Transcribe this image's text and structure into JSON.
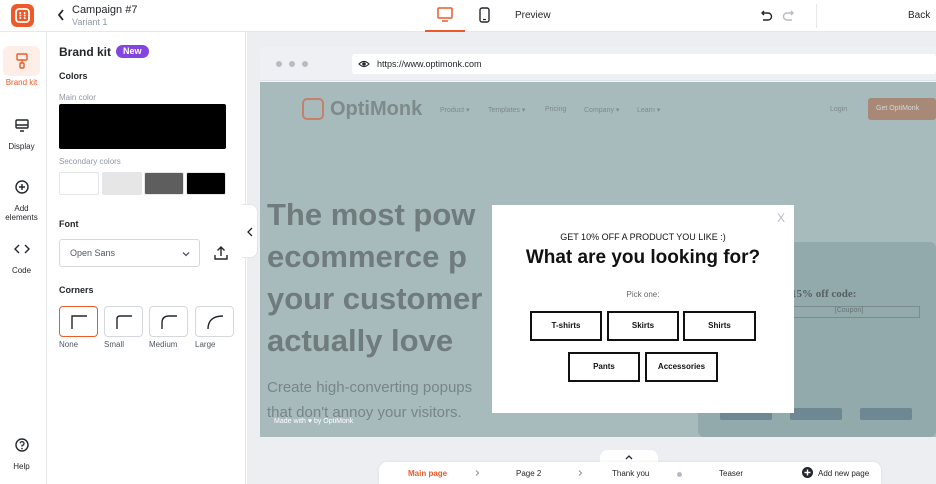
{
  "topbar": {
    "campaign_title": "Campaign #7",
    "variant": "Variant 1",
    "preview_label": "Preview",
    "back_label": "Back"
  },
  "rail": {
    "items": [
      {
        "label": "Brand kit",
        "icon": "brand-kit-icon"
      },
      {
        "label": "Display",
        "icon": "display-icon"
      },
      {
        "label": "Add elements",
        "icon": "add-elements-icon"
      },
      {
        "label": "Code",
        "icon": "code-icon"
      },
      {
        "label": "Help",
        "icon": "help-icon"
      }
    ]
  },
  "panel": {
    "title": "Brand kit",
    "badge": "New",
    "colors_heading": "Colors",
    "main_color_label": "Main color",
    "main_color": "#000000",
    "secondary_label": "Secondary colors",
    "secondary_colors": [
      "#ffffff",
      "#e6e6e6",
      "#5e5e5e",
      "#000000"
    ],
    "font_heading": "Font",
    "font_value": "Open Sans",
    "corners_heading": "Corners",
    "corners": [
      "None",
      "Small",
      "Medium",
      "Large"
    ],
    "corner_selected": "None"
  },
  "browser": {
    "url": "https://www.optimonk.com"
  },
  "site": {
    "brand": "OptiMonk",
    "nav": [
      "Product ▾",
      "Templates ▾",
      "Pricing",
      "Company ▾",
      "Learn ▾"
    ],
    "login": "Login",
    "cta": "Get OptiMonk",
    "hero_lines": [
      "The most pow",
      "ecommerce p",
      "your customer",
      "actually love"
    ],
    "hero_sub_lines": [
      "Create high-converting popups",
      "that don't annoy your visitors."
    ],
    "made_with": "Made with ♥ by OptiMonk",
    "card_title": "our 15% off code:",
    "card_code": "[Coupon]"
  },
  "popup": {
    "kicker": "GET 10% OFF A PRODUCT YOU LIKE :)",
    "headline": "What are you looking for?",
    "pick": "Pick one:",
    "close": "X",
    "options": [
      "T-shirts",
      "Skirts",
      "Shirts",
      "Pants",
      "Accessories"
    ]
  },
  "pages": {
    "items": [
      "Main page",
      "Page 2",
      "Thank you",
      "Teaser"
    ],
    "active": "Main page",
    "add_label": "Add new page"
  },
  "colors": {
    "accent": "#ed5a29",
    "badge": "#8444e1"
  }
}
